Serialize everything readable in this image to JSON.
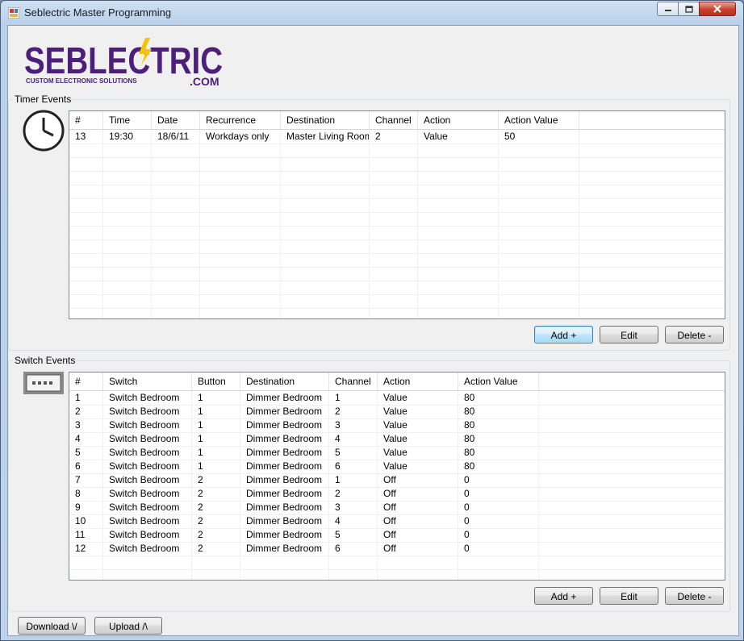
{
  "window": {
    "title": "Seblectric Master Programming"
  },
  "logo": {
    "brand": "SEBLECTRIC",
    "tagline": "CUSTOM ELECTRONIC SOLUTIONS",
    "domain": ".COM"
  },
  "timer": {
    "group_title": "Timer Events",
    "icon": "clock-icon",
    "columns": [
      "#",
      "Time",
      "Date",
      "Recurrence",
      "Destination",
      "Channel",
      "Action",
      "Action Value"
    ],
    "rows": [
      [
        "13",
        "19:30",
        "18/6/11",
        "Workdays only",
        "Master Living Room",
        "2",
        "Value",
        "50"
      ]
    ],
    "add_label": "Add +",
    "edit_label": "Edit",
    "delete_label": "Delete -"
  },
  "switch": {
    "group_title": "Switch Events",
    "icon": "switch-panel-icon",
    "columns": [
      "#",
      "Switch",
      "Button",
      "Destination",
      "Channel",
      "Action",
      "Action Value"
    ],
    "rows": [
      [
        "1",
        "Switch Bedroom",
        "1",
        "Dimmer Bedroom",
        "1",
        "Value",
        "80"
      ],
      [
        "2",
        "Switch Bedroom",
        "1",
        "Dimmer Bedroom",
        "2",
        "Value",
        "80"
      ],
      [
        "3",
        "Switch Bedroom",
        "1",
        "Dimmer Bedroom",
        "3",
        "Value",
        "80"
      ],
      [
        "4",
        "Switch Bedroom",
        "1",
        "Dimmer Bedroom",
        "4",
        "Value",
        "80"
      ],
      [
        "5",
        "Switch Bedroom",
        "1",
        "Dimmer Bedroom",
        "5",
        "Value",
        "80"
      ],
      [
        "6",
        "Switch Bedroom",
        "1",
        "Dimmer Bedroom",
        "6",
        "Value",
        "80"
      ],
      [
        "7",
        "Switch Bedroom",
        "2",
        "Dimmer Bedroom",
        "1",
        "Off",
        "0"
      ],
      [
        "8",
        "Switch Bedroom",
        "2",
        "Dimmer Bedroom",
        "2",
        "Off",
        "0"
      ],
      [
        "9",
        "Switch Bedroom",
        "2",
        "Dimmer Bedroom",
        "3",
        "Off",
        "0"
      ],
      [
        "10",
        "Switch Bedroom",
        "2",
        "Dimmer Bedroom",
        "4",
        "Off",
        "0"
      ],
      [
        "11",
        "Switch Bedroom",
        "2",
        "Dimmer Bedroom",
        "5",
        "Off",
        "0"
      ],
      [
        "12",
        "Switch Bedroom",
        "2",
        "Dimmer Bedroom",
        "6",
        "Off",
        "0"
      ]
    ],
    "add_label": "Add +",
    "edit_label": "Edit",
    "delete_label": "Delete -"
  },
  "footer": {
    "download_label": "Download \\/",
    "upload_label": "Upload /\\"
  },
  "colors": {
    "logo_purple": "#4b1f7a",
    "logo_bolt": "#f5c400",
    "close_red": "#c8412c"
  }
}
